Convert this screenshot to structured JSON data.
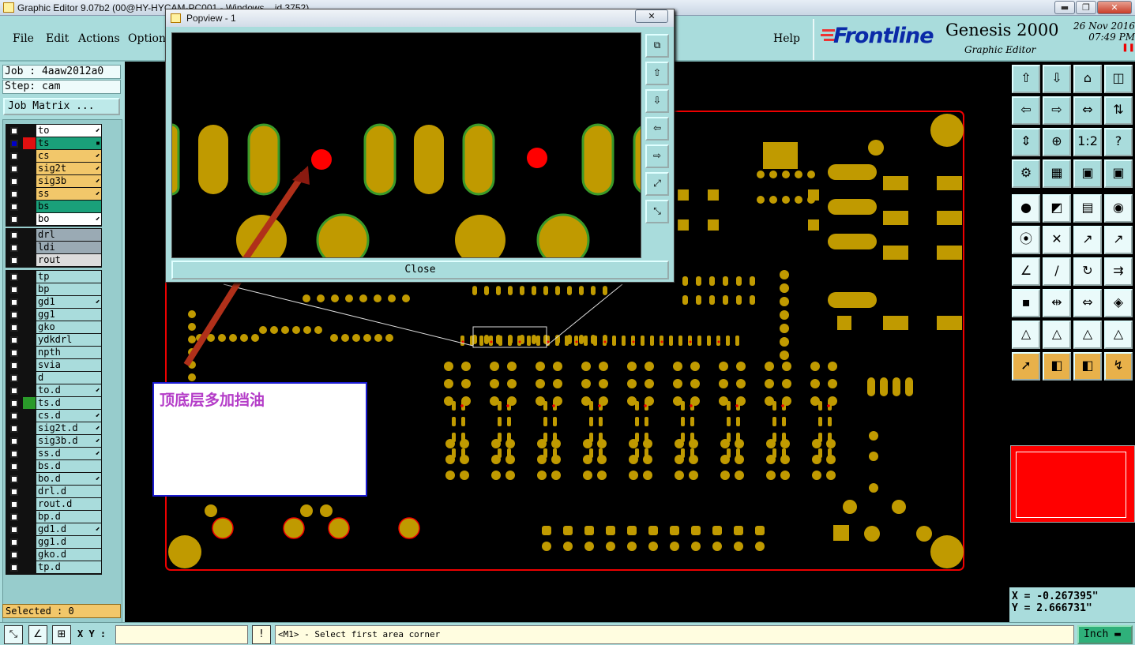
{
  "window": {
    "title": "Graphic Editor 9.07b2 (00@HY-HYCAM-PC001 - Windows ...id 3752)",
    "min_label": "▬",
    "max_label": "❐",
    "close_label": "✕"
  },
  "menu": {
    "file": "File",
    "edit": "Edit",
    "actions": "Actions",
    "options": "Options",
    "help": "Help"
  },
  "brand": {
    "frontline": "Frontline",
    "product": "Genesis 2000",
    "subtitle": "Graphic Editor",
    "date": "26 Nov 2016",
    "time": "07:49 PM"
  },
  "job": {
    "job_label": "Job : 4aaw2012a0",
    "step_label": "Step: cam",
    "matrix_button": "Job Matrix ..."
  },
  "layers": {
    "group1": [
      {
        "name": "to",
        "color": "#ffffff",
        "mark": "⬋"
      },
      {
        "name": "ts",
        "color": "#1aa07a",
        "mark": "▪"
      },
      {
        "name": "cs",
        "color": "#f2c76a",
        "mark": "⬋"
      },
      {
        "name": "sig2t",
        "color": "#f2c76a",
        "mark": "⬋"
      },
      {
        "name": "sig3b",
        "color": "#f2c76a",
        "mark": "⬋"
      },
      {
        "name": "ss",
        "color": "#f2c76a",
        "mark": "⬋"
      },
      {
        "name": "bs",
        "color": "#1aa07a",
        "mark": ""
      },
      {
        "name": "bo",
        "color": "#ffffff",
        "mark": "⬋"
      }
    ],
    "group2": [
      {
        "name": "drl",
        "color": "#9aaab4",
        "mark": ""
      },
      {
        "name": "ldi",
        "color": "#9aaab4",
        "mark": ""
      },
      {
        "name": "rout",
        "color": "#dcdcdc",
        "mark": ""
      }
    ],
    "group3": [
      {
        "name": "tp",
        "mark": ""
      },
      {
        "name": "bp",
        "mark": ""
      },
      {
        "name": "gd1",
        "mark": "⬋"
      },
      {
        "name": "gg1",
        "mark": ""
      },
      {
        "name": "gko",
        "mark": ""
      },
      {
        "name": "ydkdrl",
        "mark": ""
      },
      {
        "name": "npth",
        "mark": ""
      },
      {
        "name": "svia",
        "mark": ""
      },
      {
        "name": "d",
        "mark": ""
      },
      {
        "name": "to.d",
        "mark": "⬋"
      },
      {
        "name": "ts.d",
        "mark": ""
      },
      {
        "name": "cs.d",
        "mark": "⬋"
      },
      {
        "name": "sig2t.d",
        "mark": "⬋"
      },
      {
        "name": "sig3b.d",
        "mark": "⬋"
      },
      {
        "name": "ss.d",
        "mark": "⬋"
      },
      {
        "name": "bs.d",
        "mark": ""
      },
      {
        "name": "bo.d",
        "mark": "⬋"
      },
      {
        "name": "drl.d",
        "mark": ""
      },
      {
        "name": "rout.d",
        "mark": ""
      },
      {
        "name": "bp.d",
        "mark": ""
      },
      {
        "name": "gd1.d",
        "mark": "⬋"
      },
      {
        "name": "gg1.d",
        "mark": ""
      },
      {
        "name": "gko.d",
        "mark": ""
      },
      {
        "name": "tp.d",
        "mark": ""
      }
    ]
  },
  "selected": "Selected : 0",
  "coords": {
    "x": "X = -0.267395\"",
    "y": "Y = 2.666731\""
  },
  "status": {
    "xy_label": "X Y :",
    "xy_value": "",
    "message": "<M1> - Select first area corner",
    "units": "Inch"
  },
  "popview": {
    "title": "Popview - 1",
    "close_button": "Close"
  },
  "note": {
    "text": "顶底层多加挡油"
  },
  "colors": {
    "panel": "#a9dcdc",
    "pad": "#c09a00",
    "outline": "#ff0000",
    "mask_ring": "#3a9a2a"
  }
}
